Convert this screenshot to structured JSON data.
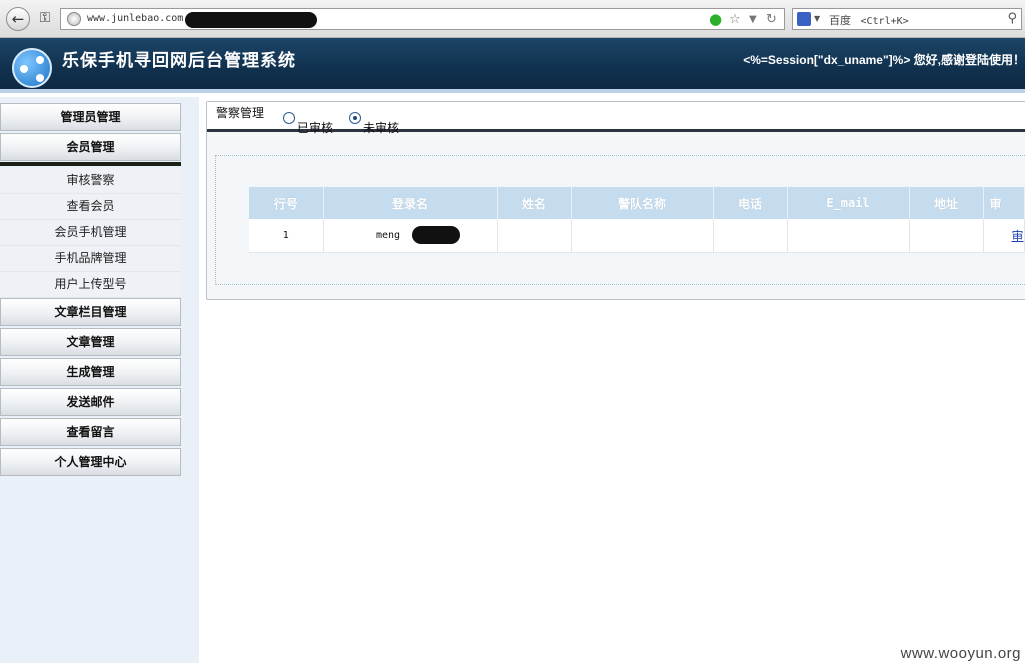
{
  "browser": {
    "url": "www.junlebao.com",
    "search_engine": "百度",
    "search_hint": "<Ctrl+K>"
  },
  "header": {
    "system_title": "乐保手机寻回网后台管理系统",
    "welcome_text": "<%=Session[\"dx_uname\"]%> 您好,感谢登陆使用！"
  },
  "menu": {
    "admin_mgmt": "管理员管理",
    "member_mgmt": "会员管理",
    "sub_items": [
      "审核警察",
      "查看会员",
      "会员手机管理",
      "手机品牌管理",
      "用户上传型号"
    ],
    "column_mgmt": "文章栏目管理",
    "article_mgmt": "文章管理",
    "generate_mgmt": "生成管理",
    "send_mail": "发送邮件",
    "view_messages": "查看留言",
    "personal_center": "个人管理中心"
  },
  "panel": {
    "title": "警察管理",
    "radio_reviewed": "已审核",
    "radio_unreviewed": "未审核",
    "selected": "未审核"
  },
  "table": {
    "headers": [
      "行号",
      "登录名",
      "姓名",
      "警队名称",
      "电话",
      "E_mail",
      "地址",
      "审"
    ],
    "rows": [
      {
        "row_no": "1",
        "login": "meng",
        "name": "",
        "team": "",
        "phone": "",
        "email": "",
        "address": "",
        "action": "审"
      }
    ]
  },
  "watermark": "www.wooyun.org",
  "colors": {
    "header_bg": "#10314e",
    "table_header": "#c5dcee",
    "link": "#1a3fb0"
  }
}
